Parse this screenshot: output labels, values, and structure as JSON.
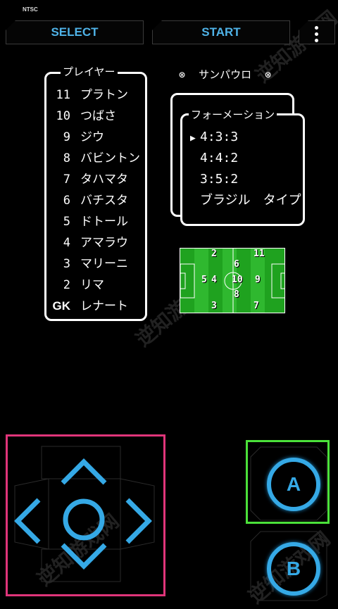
{
  "system": {
    "video_mode": "NTSC"
  },
  "toolbar": {
    "select_label": "SELECT",
    "start_label": "START",
    "menu_icon": "more-vert-icon"
  },
  "players_panel": {
    "title": "プレイヤー",
    "players": [
      {
        "num": "11",
        "name": "プラトン"
      },
      {
        "num": "10",
        "name": "つばさ"
      },
      {
        "num": "9",
        "name": "ジウ"
      },
      {
        "num": "8",
        "name": "バビントン"
      },
      {
        "num": "7",
        "name": "タハマタ"
      },
      {
        "num": "6",
        "name": "バチスタ"
      },
      {
        "num": "5",
        "name": "ドトール"
      },
      {
        "num": "4",
        "name": "アマラウ"
      },
      {
        "num": "3",
        "name": "マリーニ"
      },
      {
        "num": "2",
        "name": "リマ"
      },
      {
        "num": "GK",
        "name": "レナート"
      }
    ]
  },
  "team": {
    "name": "サンパウロ",
    "ball_icon": "soccer-ball-icon"
  },
  "formation_panel": {
    "title": "フォーメーション",
    "cursor": "▶",
    "selected_index": 0,
    "options": [
      "4:3:3",
      "4:4:2",
      "3:5:2",
      "ブラジル　タイプ"
    ]
  },
  "pitch": {
    "positions": [
      "2",
      "11",
      "6",
      "5",
      "4",
      "10",
      "9",
      "8",
      "3",
      "7"
    ]
  },
  "controls": {
    "dpad": {
      "up_icon": "chevron-up-icon",
      "down_icon": "chevron-down-icon",
      "left_icon": "chevron-left-icon",
      "right_icon": "chevron-right-icon",
      "center_icon": "circle-icon"
    },
    "a_button": "A",
    "b_button": "B",
    "accent_color": "#35a9e6",
    "dpad_highlight_color": "#e0357a",
    "a_highlight_color": "#4be13a"
  },
  "watermark": "逆知游戏网"
}
